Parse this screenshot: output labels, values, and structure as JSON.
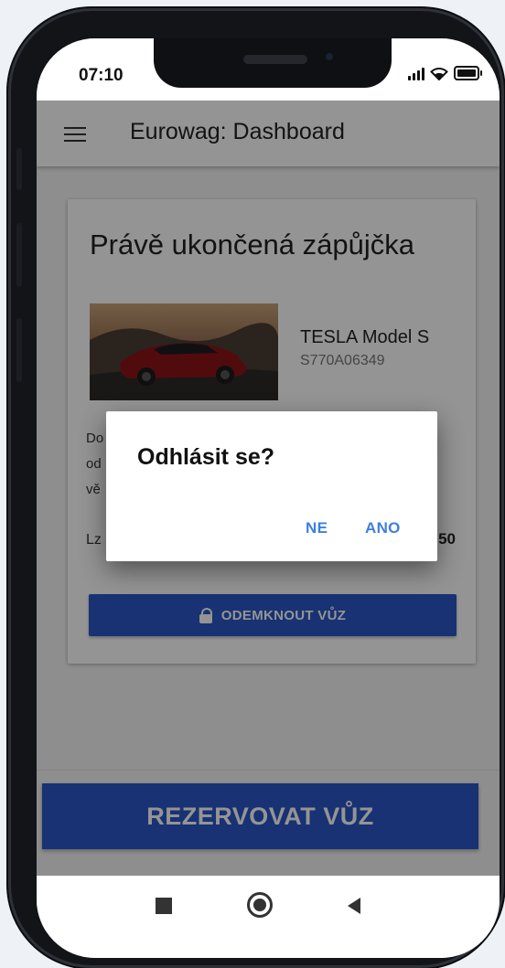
{
  "status_bar": {
    "time": "07:10",
    "signal_icon": "signal-icon",
    "wifi_icon": "wifi-icon",
    "battery_icon": "battery-icon"
  },
  "app_bar": {
    "menu_icon": "menu-icon",
    "title": "Eurowag: Dashboard"
  },
  "card": {
    "title": "Právě ukončená zápůjčka",
    "car_name": "TESLA Model S",
    "car_plate": "S770A06349",
    "description_partial": [
      "Do",
      "od",
      "vě"
    ],
    "label_partial": "Lz",
    "value_partial": "50",
    "unlock_label": "ODEMKNOUT VŮZ",
    "unlock_icon": "lock-icon"
  },
  "reserve_button": {
    "label": "REZERVOVAT VŮZ"
  },
  "nav_bar": {
    "recents_icon": "square-icon",
    "home_icon": "circle-icon",
    "back_icon": "back-triangle-icon"
  },
  "dialog": {
    "title": "Odhlásit se?",
    "cancel_label": "NE",
    "confirm_label": "ANO"
  },
  "colors": {
    "primary": "#2a56c6",
    "dialog_button": "#3d7fe0",
    "scrim": "rgba(0,0,0,0.42)"
  }
}
